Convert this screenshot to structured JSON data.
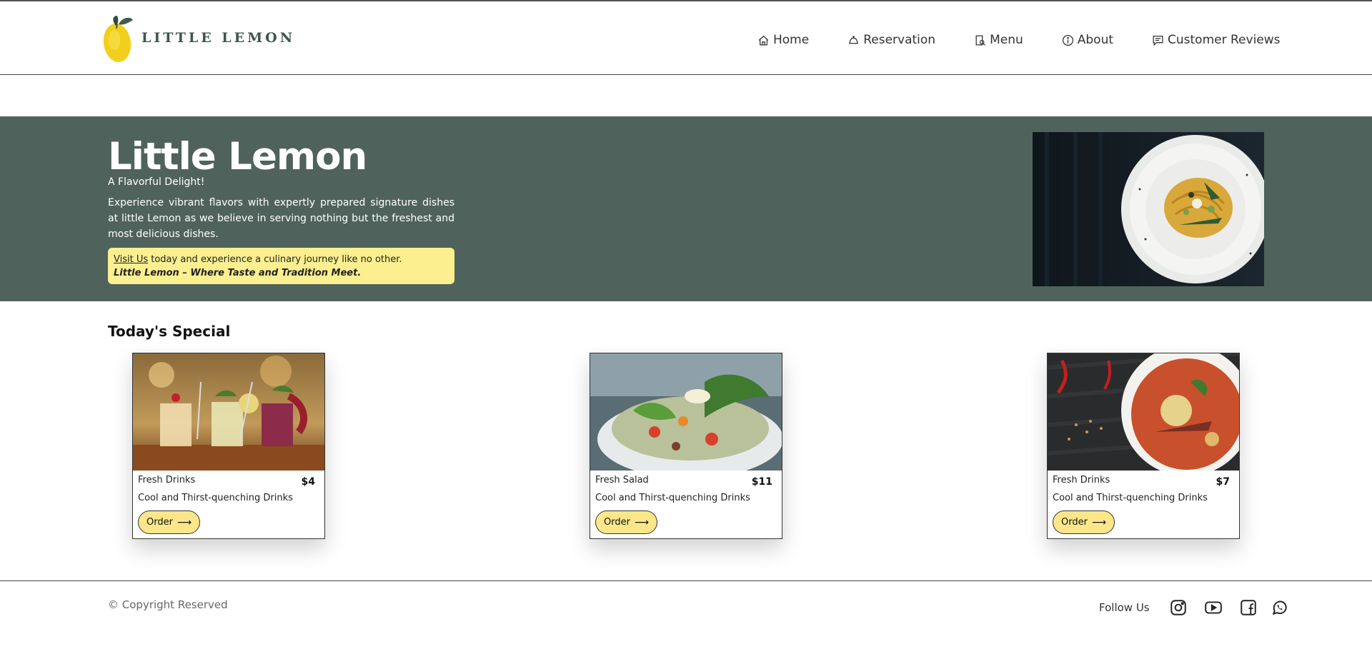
{
  "header": {
    "brand": "LITTLE LEMON",
    "nav": [
      {
        "label": "Home",
        "icon": "home-icon"
      },
      {
        "label": "Reservation",
        "icon": "bell-icon"
      },
      {
        "label": "Menu",
        "icon": "menu-icon"
      },
      {
        "label": "About",
        "icon": "info-icon"
      },
      {
        "label": "Customer Reviews",
        "icon": "comment-icon"
      }
    ]
  },
  "hero": {
    "title": "Little Lemon",
    "subtitle": "A Flavorful Delight!",
    "description": "Experience vibrant flavors with expertly prepared signature dishes at little Lemon as we believe in serving nothing but the freshest and most delicious dishes.",
    "callout_link": "Visit Us",
    "callout_text": " today and experience a culinary journey like no other.",
    "callout_tagline": "Little Lemon – Where Taste and Tradition Meet."
  },
  "specials": {
    "title": "Today's Special",
    "cards": [
      {
        "name": "Fresh Drinks",
        "price": "$4",
        "description": "Cool and Thirst-quenching Drinks",
        "button": "Order"
      },
      {
        "name": "Fresh Salad",
        "price": "$11",
        "description": "Cool and Thirst-quenching Drinks",
        "button": "Order"
      },
      {
        "name": "Fresh Drinks",
        "price": "$7",
        "description": "Cool and Thirst-quenching Drinks",
        "button": "Order"
      }
    ]
  },
  "footer": {
    "copyright": "© Copyright Reserved",
    "follow": "Follow Us",
    "social": [
      "instagram-icon",
      "youtube-icon",
      "facebook-icon",
      "whatsapp-icon"
    ]
  },
  "colors": {
    "hero_bg": "#4f635c",
    "accent_yellow": "#fbef8f",
    "button_yellow": "#fbe78a",
    "brand_text": "#3f5550"
  }
}
